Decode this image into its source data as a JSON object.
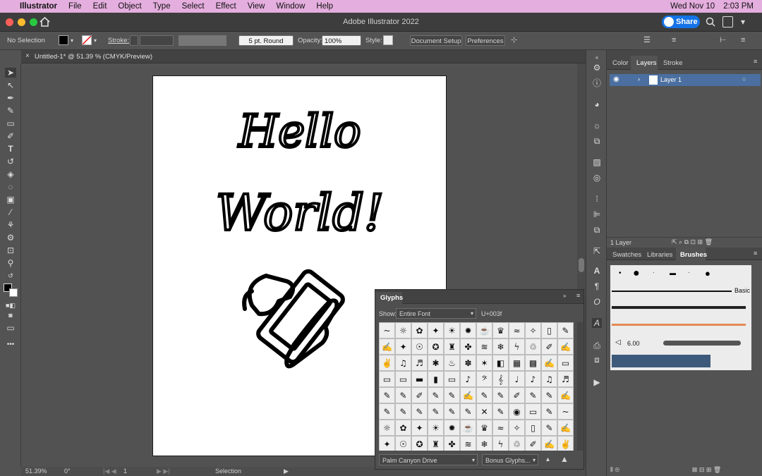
{
  "mac_menu": {
    "app": "Illustrator",
    "items": [
      "File",
      "Edit",
      "Object",
      "Type",
      "Select",
      "Effect",
      "View",
      "Window",
      "Help"
    ],
    "clock": "Wed Nov 10",
    "time": "2:03 PM"
  },
  "titlebar": {
    "title": "Adobe Illustrator 2022",
    "share": "Share"
  },
  "control": {
    "selection": "No Selection",
    "stroke_label": "Stroke:",
    "brush": "5 pt. Round",
    "opacity_label": "Opacity:",
    "opacity": "100%",
    "style_label": "Style:",
    "doc_setup": "Document Setup",
    "preferences": "Preferences"
  },
  "doc_tab": {
    "title": "Untitled-1* @ 51.39 % (CMYK/Preview)"
  },
  "artwork": {
    "line1": "Hello",
    "line2": "World!"
  },
  "status": {
    "zoom": "51.39%",
    "rotation": "0°",
    "artboard": "1",
    "tool": "Selection"
  },
  "layers_panel": {
    "tabs": [
      "Color",
      "Layers",
      "Stroke"
    ],
    "active_tab": "Layers",
    "layer_name": "Layer 1",
    "footer": "1 Layer"
  },
  "brushes_panel": {
    "tabs": [
      "Swatches",
      "Libraries",
      "Brushes"
    ],
    "active_tab": "Brushes",
    "basic": "Basic",
    "size": "6.00"
  },
  "glyphs_panel": {
    "title": "Glyphs",
    "show_label": "Show:",
    "show_value": "Entire Font",
    "unicode": "U+003f",
    "font": "Palm Canyon Drive",
    "style": "Bonus Glyphs..."
  },
  "colors": {
    "menubar": "#e4aede",
    "share": "#1473e6",
    "layer_highlight": "#4a6fa0"
  }
}
